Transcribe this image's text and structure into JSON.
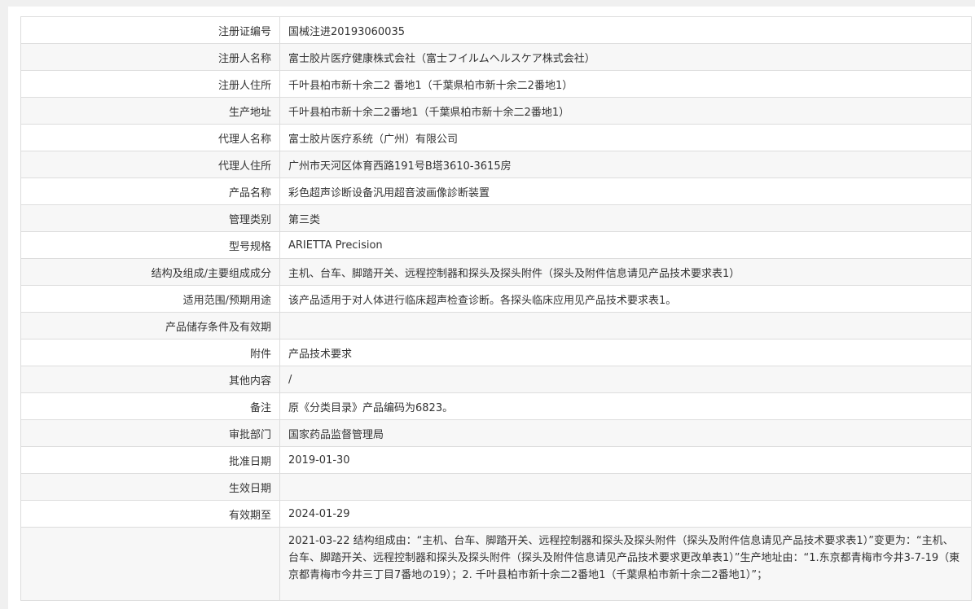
{
  "record": {
    "rows": [
      {
        "label": "注册证编号",
        "value": "国械注进20193060035"
      },
      {
        "label": "注册人名称",
        "value": "富士胶片医疗健康株式会社（富士フイルムヘルスケア株式会社）"
      },
      {
        "label": "注册人住所",
        "value": "千叶县柏市新十余二2 番地1（千葉県柏市新十余二2番地1）"
      },
      {
        "label": "生产地址",
        "value": "千叶县柏市新十余二2番地1（千葉県柏市新十余二2番地1）"
      },
      {
        "label": "代理人名称",
        "value": "富士胶片医疗系统（广州）有限公司"
      },
      {
        "label": "代理人住所",
        "value": "广州市天河区体育西路191号B塔3610-3615房"
      },
      {
        "label": "产品名称",
        "value": "彩色超声诊断设备汎用超音波画像診断装置"
      },
      {
        "label": "管理类别",
        "value": "第三类"
      },
      {
        "label": "型号规格",
        "value": "ARIETTA Precision"
      },
      {
        "label": "结构及组成/主要组成成分",
        "value": "主机、台车、脚踏开关、远程控制器和探头及探头附件（探头及附件信息请见产品技术要求表1）"
      },
      {
        "label": "适用范围/预期用途",
        "value": "该产品适用于对人体进行临床超声检查诊断。各探头临床应用见产品技术要求表1。"
      },
      {
        "label": "产品储存条件及有效期",
        "value": ""
      },
      {
        "label": "附件",
        "value": "产品技术要求"
      },
      {
        "label": "其他内容",
        "value": "/"
      },
      {
        "label": "备注",
        "value": "原《分类目录》产品编码为6823。"
      },
      {
        "label": "审批部门",
        "value": "国家药品监督管理局"
      },
      {
        "label": "批准日期",
        "value": "2019-01-30"
      },
      {
        "label": "生效日期",
        "value": ""
      },
      {
        "label": "有效期至",
        "value": "2024-01-29"
      }
    ],
    "change_history": {
      "label": "",
      "value": "2021-03-22 结构组成由：“主机、台车、脚踏开关、远程控制器和探头及探头附件（探头及附件信息请见产品技术要求表1）”变更为：“主机、台车、脚踏开关、远程控制器和探头及探头附件（探头及附件信息请见产品技术要求更改单表1）”生产地址由：“1.东京都青梅市今井3-7-19（東京都青梅市今井三丁目7番地の19）；2. 千叶县柏市新十余二2番地1（千葉県柏市新十余二2番地1）”；"
    }
  }
}
